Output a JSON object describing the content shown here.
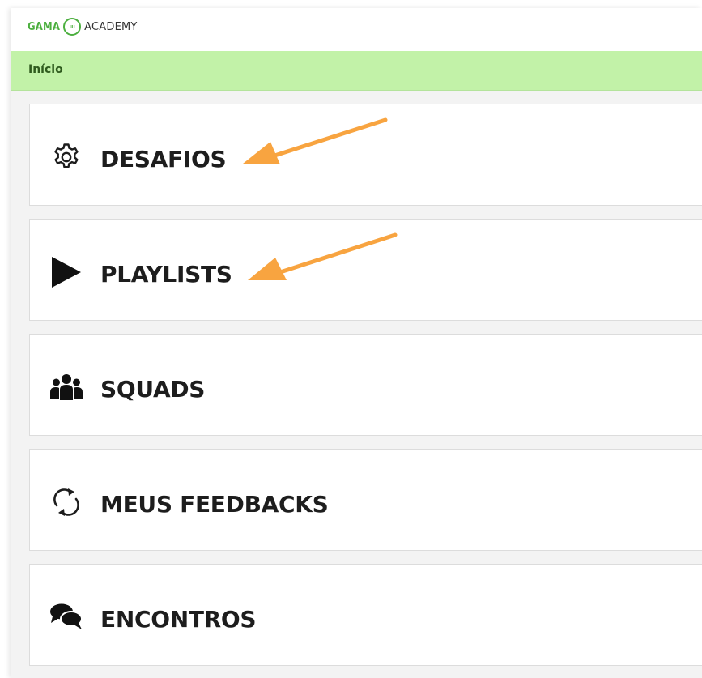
{
  "logo": {
    "left": "GAMA",
    "badge": "ııı",
    "right": "ACADEMY"
  },
  "breadcrumb": {
    "current": "Início"
  },
  "menu": [
    {
      "label": "DESAFIOS",
      "icon": "gear-icon"
    },
    {
      "label": "PLAYLISTS",
      "icon": "play-icon"
    },
    {
      "label": "SQUADS",
      "icon": "users-icon"
    },
    {
      "label": "MEUS FEEDBACKS",
      "icon": "sync-icon"
    },
    {
      "label": "ENCONTROS",
      "icon": "comments-icon"
    }
  ],
  "annotations": {
    "arrow_color": "#f8a440"
  },
  "colors": {
    "accent": "#4caf3f",
    "breadcrumb_bg": "#c2f2a8"
  }
}
